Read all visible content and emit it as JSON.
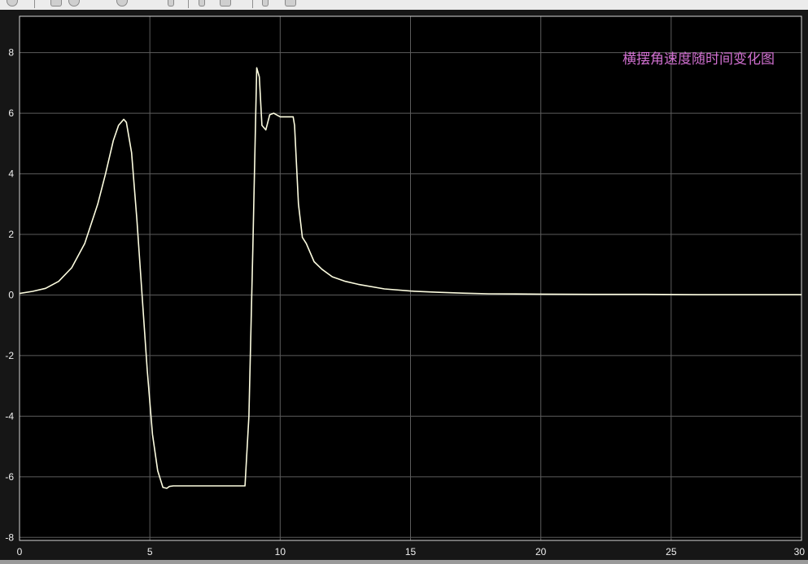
{
  "colors": {
    "background": "#000000",
    "frame": "#161616",
    "grid": "#5c5c5c",
    "axes_box": "#d8d8d8",
    "tick_text": "#f0f0f0",
    "trace": "#fdfde0",
    "title": "#d070d0"
  },
  "toolbar": {
    "icons": [
      "settings-icon",
      "run-icon",
      "step-icon",
      "stop-icon",
      "zoom-icon",
      "cursor-icon",
      "print-icon",
      "copy-icon"
    ]
  },
  "chart_data": {
    "type": "line",
    "title": "横摆角速度随时间变化图",
    "xlabel": "",
    "ylabel": "",
    "xlim": [
      0,
      30
    ],
    "ylim": [
      -8.1,
      9.2
    ],
    "grid": true,
    "legend": "none",
    "x_ticks": [
      0,
      5,
      10,
      15,
      20,
      25,
      30
    ],
    "y_ticks": [
      -8,
      -6,
      -4,
      -2,
      0,
      2,
      4,
      6,
      8
    ],
    "series": [
      {
        "x": [
          0,
          0.5,
          1,
          1.5,
          2,
          2.5,
          3,
          3.3,
          3.6,
          3.8,
          4,
          4.1,
          4.3,
          4.5,
          4.7,
          4.9,
          5.1,
          5.3,
          5.5,
          5.65,
          5.75,
          5.9,
          6.1,
          6.5,
          7,
          7.5,
          8,
          8.4,
          8.6,
          8.65,
          8.8,
          8.95,
          9.1,
          9.2,
          9.3,
          9.45,
          9.6,
          9.75,
          10,
          10.3,
          10.5,
          10.55,
          10.7,
          10.85,
          11,
          11.3,
          11.6,
          12,
          12.5,
          13,
          14,
          15,
          16,
          17,
          18,
          20,
          22,
          24,
          26,
          28,
          30
        ],
        "y": [
          0.05,
          0.12,
          0.22,
          0.45,
          0.9,
          1.7,
          3.0,
          4.0,
          5.1,
          5.6,
          5.8,
          5.7,
          4.7,
          2.5,
          0.0,
          -2.5,
          -4.6,
          -5.8,
          -6.35,
          -6.38,
          -6.32,
          -6.3,
          -6.3,
          -6.3,
          -6.3,
          -6.3,
          -6.3,
          -6.3,
          -6.3,
          -6.3,
          -4.0,
          1.5,
          7.5,
          7.2,
          5.6,
          5.45,
          5.95,
          6.0,
          5.88,
          5.88,
          5.88,
          5.6,
          3.0,
          1.9,
          1.7,
          1.1,
          0.85,
          0.6,
          0.45,
          0.35,
          0.2,
          0.13,
          0.09,
          0.06,
          0.04,
          0.03,
          0.02,
          0.02,
          0.01,
          0.01,
          0.01
        ]
      }
    ]
  }
}
